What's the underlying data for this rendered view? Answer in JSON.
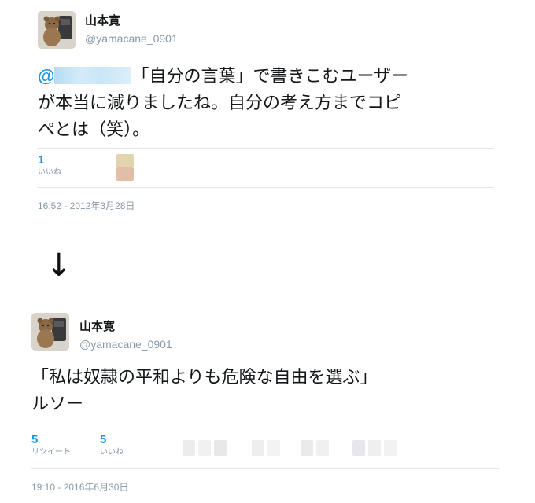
{
  "tweets": [
    {
      "author_name": "山本寛",
      "author_handle": "@yamacane_0901",
      "mention_prefix": "@",
      "text_line1": "「自分の言葉」で書きこむユーザー",
      "text_line2": "が本当に減りましたね。自分の考え方までコピ",
      "text_line3": "ぺとは（笑）。",
      "likes_count": "1",
      "likes_label": "いいね",
      "timestamp": "16:52 - 2012年3月28日"
    },
    {
      "author_name": "山本寛",
      "author_handle": "@yamacane_0901",
      "text_line1": "「私は奴隷の平和よりも危険な自由を選ぶ」",
      "text_line2": "ルソー",
      "retweets_count": "5",
      "retweets_label": "リツイート",
      "likes_count": "5",
      "likes_label": "いいね",
      "timestamp": "19:10 - 2016年6月30日"
    }
  ],
  "transition_arrow": "↓"
}
